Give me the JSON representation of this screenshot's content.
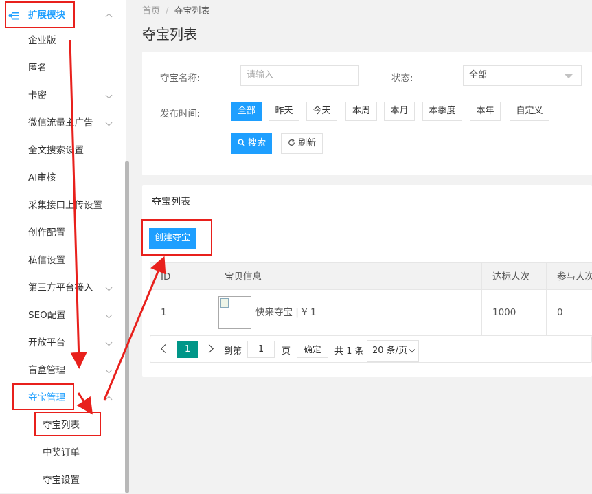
{
  "sidebar": {
    "header": {
      "label": "扩展模块",
      "icon": "sitemap-icon"
    },
    "items": [
      {
        "label": "企业版",
        "has_chevron": false
      },
      {
        "label": "匿名",
        "has_chevron": false
      },
      {
        "label": "卡密",
        "has_chevron": true
      },
      {
        "label": "微信流量主广告",
        "has_chevron": true
      },
      {
        "label": "全文搜索设置",
        "has_chevron": false
      },
      {
        "label": "AI审核",
        "has_chevron": false
      },
      {
        "label": "采集接口上传设置",
        "has_chevron": false
      },
      {
        "label": "创作配置",
        "has_chevron": false
      },
      {
        "label": "私信设置",
        "has_chevron": false
      },
      {
        "label": "第三方平台接入",
        "has_chevron": true
      },
      {
        "label": "SEO配置",
        "has_chevron": true
      },
      {
        "label": "开放平台",
        "has_chevron": true
      },
      {
        "label": "盲盒管理",
        "has_chevron": true
      },
      {
        "label": "夺宝管理",
        "has_chevron": true,
        "expanded": true
      }
    ],
    "subitems": [
      {
        "label": "夺宝列表",
        "active": true
      },
      {
        "label": "中奖订单"
      },
      {
        "label": "夺宝设置"
      }
    ]
  },
  "breadcrumb": {
    "home": "首页",
    "separator": "/",
    "current": "夺宝列表"
  },
  "page_title": "夺宝列表",
  "filter": {
    "name_label": "夺宝名称:",
    "name_placeholder": "请输入",
    "status_label": "状态:",
    "status_value": "全部",
    "time_label": "发布时间:",
    "time_options": [
      "全部",
      "昨天",
      "今天",
      "本周",
      "本月",
      "本季度",
      "本年",
      "自定义"
    ],
    "time_active": "全部",
    "search_label": "搜索",
    "refresh_label": "刷新"
  },
  "list": {
    "title": "夺宝列表",
    "create_label": "创建夺宝",
    "columns": [
      "ID",
      "宝贝信息",
      "达标人次",
      "参与人次"
    ],
    "rows": [
      {
        "id": "1",
        "info": "快来夺宝 | ¥ 1",
        "target": "1000",
        "joined": "0"
      }
    ]
  },
  "pagination": {
    "current_page": "1",
    "goto_label": "到第",
    "goto_value": "1",
    "page_unit": "页",
    "confirm_label": "确定",
    "total_label": "共 1 条",
    "page_size": "20 条/页"
  },
  "colors": {
    "accent": "#1E9FFF",
    "teal": "#009688",
    "annotation_red": "#e8201c"
  }
}
